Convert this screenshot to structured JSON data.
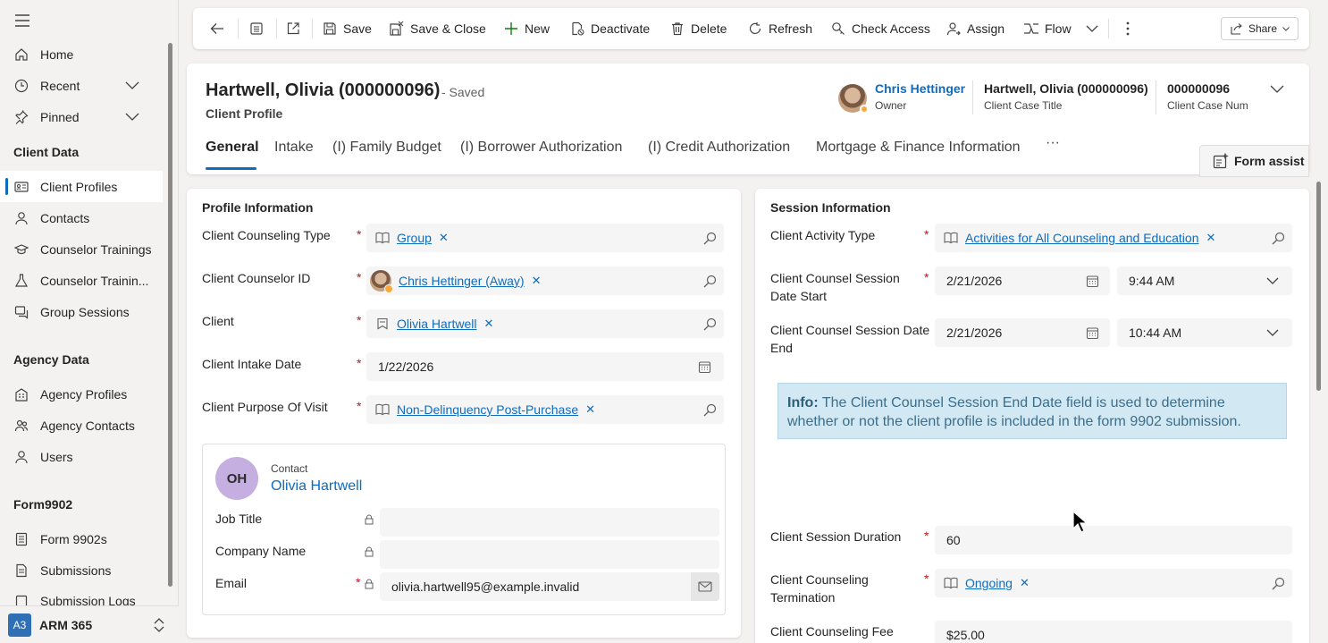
{
  "sidebar": {
    "items": [
      {
        "label": "Home",
        "icon": "home-icon"
      },
      {
        "label": "Recent",
        "icon": "clock-icon"
      },
      {
        "label": "Pinned",
        "icon": "pin-icon"
      }
    ],
    "groups": [
      {
        "title": "Client Data",
        "items": [
          "Client Profiles",
          "Contacts",
          "Counselor Trainings",
          "Counselor Trainin...",
          "Group Sessions"
        ]
      },
      {
        "title": "Agency Data",
        "items": [
          "Agency Profiles",
          "Agency Contacts",
          "Users"
        ]
      },
      {
        "title": "Form9902",
        "items": [
          "Form 9902s",
          "Submissions",
          "Submission Logs"
        ]
      }
    ],
    "selected": "Client Profiles",
    "area": {
      "badge": "A3",
      "name": "ARM 365"
    }
  },
  "commands": {
    "save": "Save",
    "save_close": "Save & Close",
    "new": "New",
    "deactivate": "Deactivate",
    "delete": "Delete",
    "refresh": "Refresh",
    "check_access": "Check Access",
    "assign": "Assign",
    "flow": "Flow",
    "share": "Share"
  },
  "header": {
    "title": "Hartwell, Olivia (000000096)",
    "saved": "- Saved",
    "form": "Client Profile",
    "owner_name": "Chris Hettinger",
    "owner_label": "Owner",
    "case_title": "Hartwell, Olivia (000000096)",
    "case_title_label": "Client Case Title",
    "case_num": "000000096",
    "case_num_label": "Client Case Num"
  },
  "tabs": [
    "General",
    "Intake",
    "(I) Family Budget",
    "(I) Borrower Authorization",
    "(I) Credit Authorization",
    "Mortgage & Finance Information"
  ],
  "tabs_more": "···",
  "form_assist": "Form assist",
  "profile": {
    "title": "Profile Information",
    "counseling_type": {
      "label": "Client Counseling Type",
      "value": "Group"
    },
    "counselor_id": {
      "label": "Client Counselor ID",
      "value": "Chris Hettinger (Away)"
    },
    "client": {
      "label": "Client",
      "value": "Olivia Hartwell"
    },
    "intake_date": {
      "label": "Client Intake Date",
      "value": "1/22/2026"
    },
    "purpose": {
      "label": "Client Purpose Of Visit",
      "value": "Non-Delinquency Post-Purchase"
    },
    "contact_card": {
      "initials": "OH",
      "type": "Contact",
      "name": "Olivia Hartwell",
      "job_title_label": "Job Title",
      "company_label": "Company Name",
      "email_label": "Email",
      "email": "olivia.hartwell95@example.invalid"
    }
  },
  "session": {
    "title": "Session Information",
    "activity_type": {
      "label": "Client Activity Type",
      "value": "Activities for All Counseling and Education"
    },
    "start": {
      "label_1": "Client Counsel Session",
      "label_2": "Date Start",
      "date": "2/21/2026",
      "time": "9:44 AM"
    },
    "end": {
      "label_1": "Client Counsel Session Date",
      "label_2": "End",
      "date": "2/21/2026",
      "time": "10:44 AM"
    },
    "info_bold": "Info:",
    "info_text": " The Client Counsel Session End Date field is used to determine whether or not the client profile is included in the form 9902 submission.",
    "duration": {
      "label": "Client Session Duration",
      "value": "60"
    },
    "termination": {
      "label_1": "Client Counseling",
      "label_2": "Termination",
      "value": "Ongoing"
    },
    "fee": {
      "label": "Client Counseling Fee",
      "value": "$25.00"
    }
  },
  "colors": {
    "accent": "#0f6cbd",
    "required": "#c50f1f",
    "info_bg": "#d2e8f3"
  }
}
